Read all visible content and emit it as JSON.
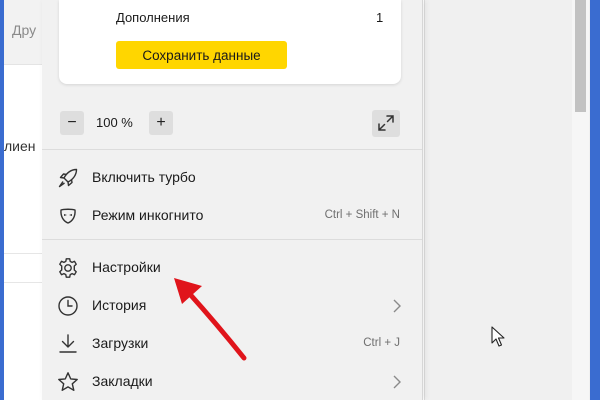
{
  "background_page": {
    "top_text": "Дру",
    "mid_text": "лиен"
  },
  "menu": {
    "addons": {
      "label": "Дополнения",
      "count": "1"
    },
    "save_button": "Сохранить данные",
    "zoom": {
      "minus": "−",
      "value": "100 %",
      "plus": "+"
    },
    "items": [
      {
        "label": "Включить турбо",
        "icon": "rocket-icon",
        "shortcut": ""
      },
      {
        "label": "Режим инкогнито",
        "icon": "incognito-mask-icon",
        "shortcut": "Ctrl + Shift + N"
      },
      {
        "label": "Настройки",
        "icon": "gear-icon",
        "shortcut": ""
      },
      {
        "label": "История",
        "icon": "clock-icon",
        "shortcut": "",
        "submenu": true
      },
      {
        "label": "Загрузки",
        "icon": "download-icon",
        "shortcut": "Ctrl + J"
      },
      {
        "label": "Закладки",
        "icon": "star-icon",
        "shortcut": "",
        "submenu": true
      }
    ]
  },
  "colors": {
    "accent_yellow": "#ffd600",
    "frame_blue": "#3a6cd0",
    "annotation_red": "#e0141b",
    "menu_background": "#f1f1f1"
  }
}
